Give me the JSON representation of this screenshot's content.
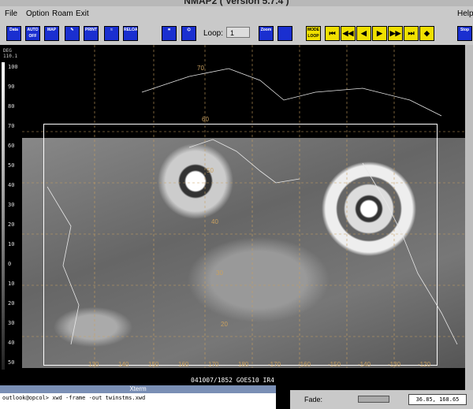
{
  "window": {
    "title": "NMAP2 ( Version 5.7.4 )"
  },
  "menu": {
    "items": [
      "File",
      "Option",
      "Roam",
      "Exit"
    ],
    "help": "Help"
  },
  "toolbar": {
    "buttons": [
      {
        "label": "Data",
        "icon": "data-icon"
      },
      {
        "label": "AUTO OFF",
        "icon": "auto-update-icon"
      },
      {
        "label": "MAP",
        "icon": "map-icon"
      },
      {
        "label": "",
        "icon": "draw-icon"
      },
      {
        "label": "PRINT",
        "icon": "print-icon"
      },
      {
        "label": "",
        "icon": "overlay-icon"
      },
      {
        "label": "RELOAD",
        "icon": "reload-icon"
      },
      {
        "label": "",
        "icon": "lat-lon-icon"
      },
      {
        "label": "",
        "icon": "graph-icon"
      }
    ],
    "loop_label": "Loop:",
    "loop_value": "1",
    "zoom_label": "Zoom",
    "unzoom_label": "",
    "mode_label": "MODE LOOP",
    "stop_label": "Stop",
    "accent": "#1a2fd0",
    "play_color": "#f0e000"
  },
  "scale": {
    "header": "DEG 110.1",
    "ticks": [
      "100",
      "90",
      "80",
      "70",
      "60",
      "50",
      "40",
      "30",
      "20",
      "10",
      "0",
      "10",
      "20",
      "30",
      "40",
      "50"
    ]
  },
  "status": {
    "text": "041007/1852 GOES10 IR4"
  },
  "xterm": {
    "title": "Xterm",
    "command": "outlook@opcol> xwd -frame -out twinstms.xwd"
  },
  "fade": {
    "label": "Fade:"
  },
  "coords": {
    "value": "36.85, 168.65"
  },
  "map_labels": {
    "lon": [
      "130",
      "140",
      "150",
      "160",
      "170",
      "180",
      "-170",
      "-160",
      "-150",
      "-140",
      "-130",
      "-120"
    ],
    "lat": [
      "70",
      "60",
      "50",
      "40",
      "30",
      "20"
    ]
  }
}
